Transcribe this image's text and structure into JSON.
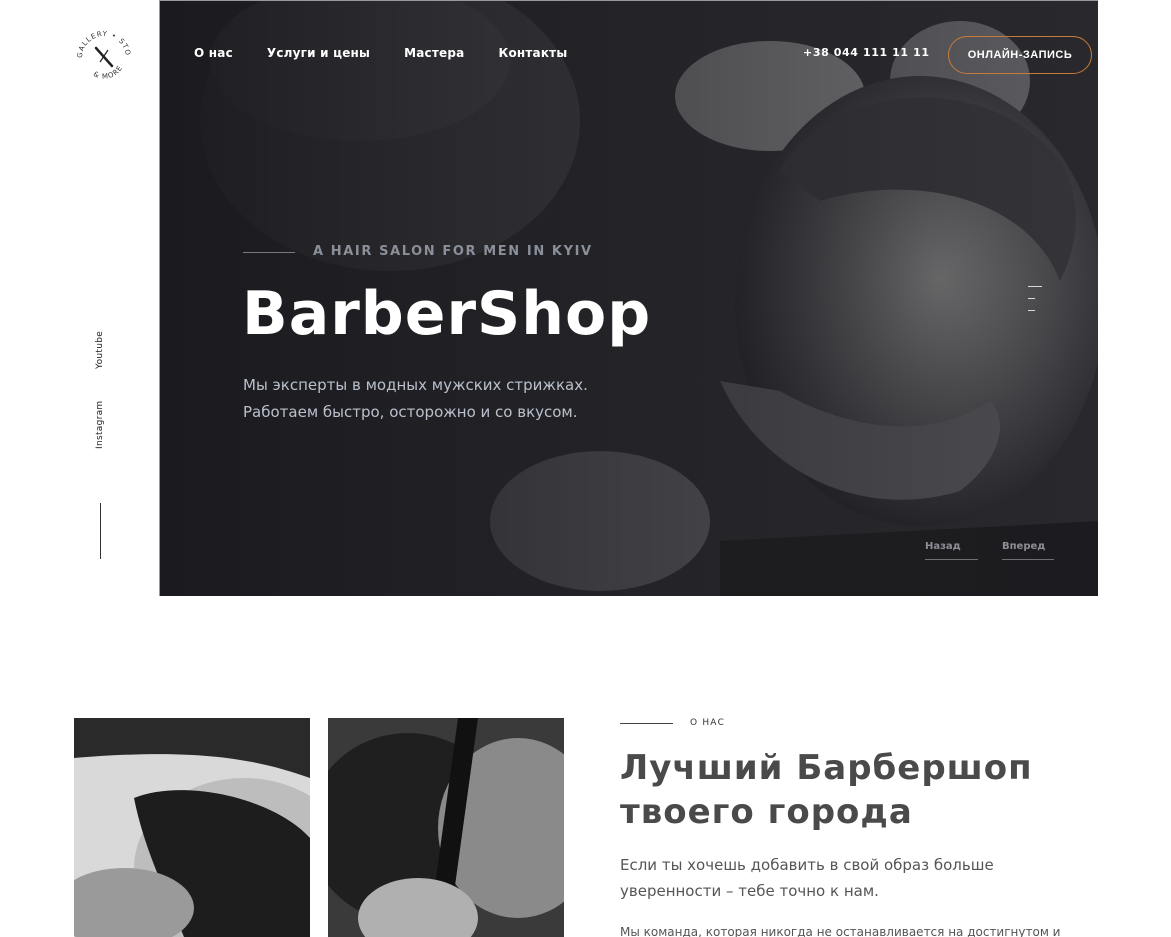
{
  "brand": {
    "logo_text_top": "GALLERY • STORE",
    "logo_text_bottom": "& MORE"
  },
  "social": {
    "youtube": "Youtube",
    "instagram": "Instagram"
  },
  "nav": {
    "items": [
      "О нас",
      "Услуги и цены",
      "Мастера",
      "Контакты"
    ],
    "phone": "+38 044 111 11 11",
    "cta": "ОНЛАЙН-ЗАПИСЬ"
  },
  "hero": {
    "kicker": "A HAIR SALON FOR MEN IN KYIV",
    "title": "BarberShop",
    "subtitle_line1": "Мы эксперты в модных мужских стрижках.",
    "subtitle_line2": "Работаем быстро, осторожно и со вкусом.",
    "prev": "Назад",
    "next": "Вперед"
  },
  "about": {
    "kicker": "О НАС",
    "title_line1": "Лучший Барбершоп",
    "title_line2": "твоего города",
    "lead_line1": "Если ты хочешь добавить в свой образ больше",
    "lead_line2": "уверенности – тебе точно к нам.",
    "body": "Мы команда, которая никогда не останавливается на достигнутом и"
  },
  "colors": {
    "accent": "#c77a3a",
    "hero_bg": "#2a2a2e"
  }
}
